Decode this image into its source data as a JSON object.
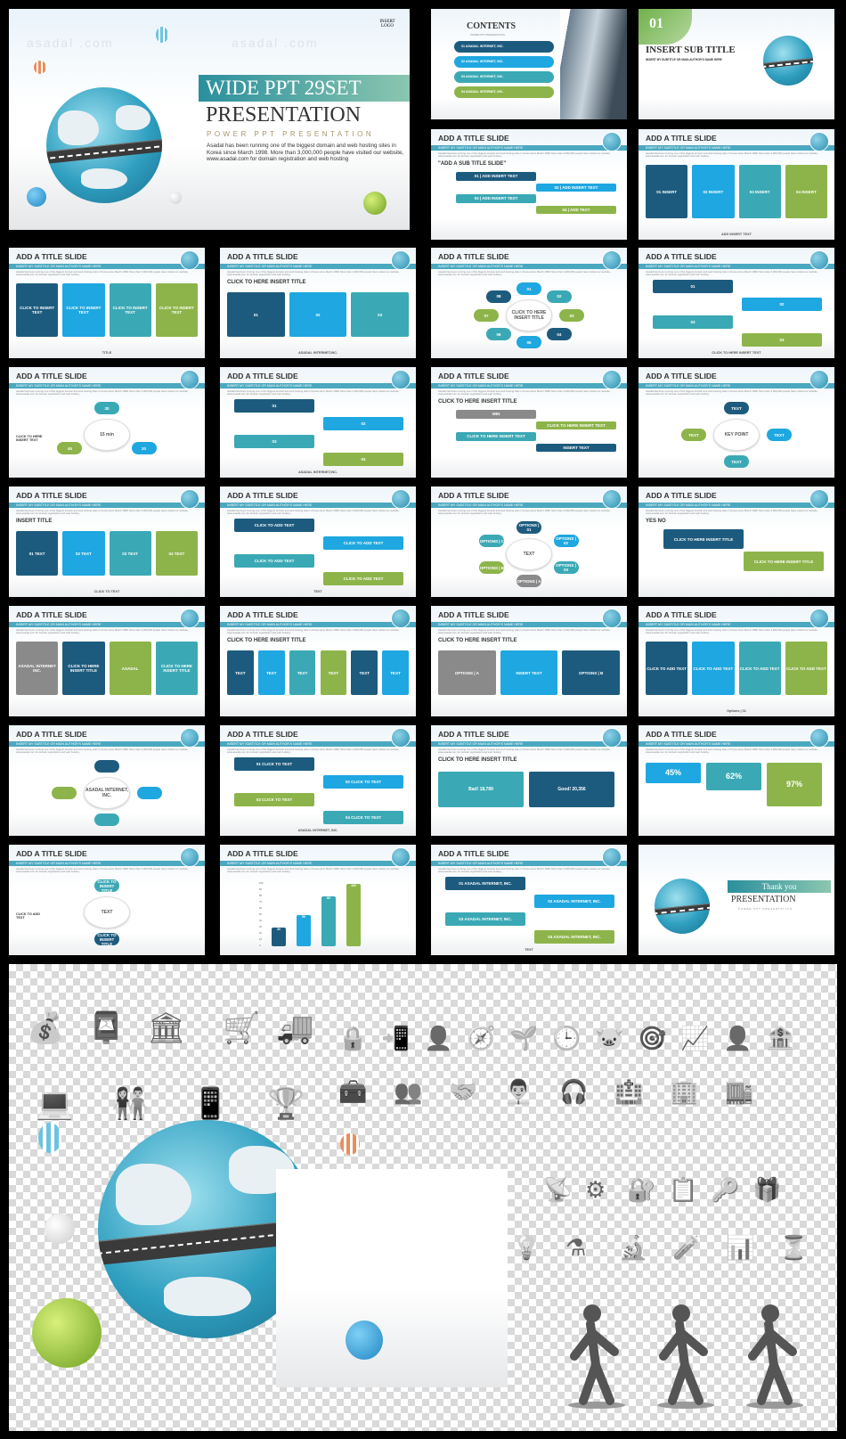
{
  "watermark": "asadal .com",
  "colors": {
    "navy": "#1d5b7e",
    "blue": "#1ea7e0",
    "teal": "#3aa9b5",
    "green": "#8db44a",
    "bar": "#4aa8c0",
    "gray": "#8a8a8a"
  },
  "cover": {
    "logo": "INSERT LOGO",
    "title": "WIDE PPT 29SET",
    "heading": "PRESENTATION",
    "subtitle": "POWER PPT PRESENTATION",
    "description": "Asadal has been running one of the biggest domain and web hosting sites in Korea since March 1998. More than 3,000,000 people have visited our website,  www.asadal.com  for domain registration and web hosting"
  },
  "common": {
    "slide_title": "ADD A TITLE SLIDE",
    "slide_subtitle": "INSERT MY SUBTITLE OR MAIN AUTHOR'S NAME HERE",
    "slide_body": "Asadal has been running one of the biggest domain and web hosting sites in Korea since March 1998. More than 3,000,000 people have visited our website, www.asadal.com for domain registration and web hosting."
  },
  "slides": [
    {
      "kind": "contents",
      "title": "CONTENTS",
      "subtitle": "POWER PPT PRESENTATION",
      "items": [
        {
          "text": "01  ASADAL INTERNET, INC.",
          "color": "navy"
        },
        {
          "text": "02  ASADAL INTERNET, INC.",
          "color": "blue"
        },
        {
          "text": "03  ASADAL INTERNET, INC.",
          "color": "teal"
        },
        {
          "text": "04  ASADAL INTERNET, INC.",
          "color": "green"
        }
      ]
    },
    {
      "kind": "section",
      "number": "01",
      "title": "INSERT SUB TITLE",
      "subtitle": "INSERT MY SUBTITLE OR MAIN AUTHOR'S NAME HERE"
    },
    {
      "kind": "stagger",
      "heading": "\"ADD A SUB TITLE SLIDE\"",
      "items": [
        {
          "text": "01 | ADD INSERT TEXT",
          "color": "navy"
        },
        {
          "text": "02 | ADD INSERT TEXT",
          "color": "blue"
        },
        {
          "text": "03 | ADD INSERT TEXT",
          "color": "teal"
        },
        {
          "text": "04 | ADD TEXT",
          "color": "green"
        }
      ]
    },
    {
      "kind": "row",
      "items": [
        {
          "text": "01 INSERT",
          "color": "navy"
        },
        {
          "text": "02 INSERT",
          "color": "blue"
        },
        {
          "text": "03 INSERT",
          "color": "teal"
        },
        {
          "text": "04 INSERT",
          "color": "green"
        }
      ],
      "caption": "ADD INSERT TEXT"
    },
    {
      "kind": "row",
      "items": [
        {
          "text": "CLICK TO INSERT TEXT",
          "color": "navy"
        },
        {
          "text": "CLICK TO INSERT TEXT",
          "color": "blue"
        },
        {
          "text": "CLICK TO INSERT TEXT",
          "color": "teal"
        },
        {
          "text": "CLICK TO INSERT TEXT",
          "color": "green"
        }
      ],
      "caption": "TITLE"
    },
    {
      "kind": "row",
      "heading": "CLICK TO HERE INSERT TITLE",
      "items": [
        {
          "text": "01",
          "color": "navy"
        },
        {
          "text": "02",
          "color": "blue"
        },
        {
          "text": "03",
          "color": "teal"
        }
      ],
      "caption": "ASADAL INTERNET,INC."
    },
    {
      "kind": "circle",
      "center": "CLICK TO HERE INSERT TITLE",
      "items": [
        {
          "text": "01",
          "color": "blue"
        },
        {
          "text": "02",
          "color": "teal"
        },
        {
          "text": "03",
          "color": "green"
        },
        {
          "text": "04",
          "color": "navy"
        },
        {
          "text": "05",
          "color": "blue"
        },
        {
          "text": "06",
          "color": "teal"
        },
        {
          "text": "07",
          "color": "green"
        },
        {
          "text": "08",
          "color": "navy"
        }
      ]
    },
    {
      "kind": "col",
      "items": [
        {
          "text": "01",
          "color": "navy"
        },
        {
          "text": "02",
          "color": "blue"
        },
        {
          "text": "03",
          "color": "teal"
        },
        {
          "text": "04",
          "color": "green"
        }
      ],
      "caption": "CLICK TO HERE INSERT TEXT"
    },
    {
      "kind": "circle",
      "center": "15 min",
      "items": [
        {
          "text": "30",
          "color": "teal"
        },
        {
          "text": "20",
          "color": "blue"
        },
        {
          "text": "45",
          "color": "green"
        }
      ],
      "side": "CLICK TO HERE INSERT TEXT"
    },
    {
      "kind": "col",
      "items": [
        {
          "text": "01",
          "color": "navy"
        },
        {
          "text": "02",
          "color": "blue"
        },
        {
          "text": "03",
          "color": "teal"
        },
        {
          "text": "04",
          "color": "green"
        }
      ],
      "caption": "ASADAL INTERNET,INC."
    },
    {
      "kind": "stagger",
      "heading": "CLICK TO HERE INSERT TITLE",
      "items": [
        {
          "text": "WIN",
          "color": "gray"
        },
        {
          "text": "CLICK TO HERE INSERT TEXT",
          "color": "green"
        },
        {
          "text": "CLICK TO HERE INSERT TEXT",
          "color": "teal"
        },
        {
          "text": "INSERT TEXT",
          "color": "navy"
        }
      ]
    },
    {
      "kind": "circle",
      "center": "KEY POINT",
      "items": [
        {
          "text": "TEXT",
          "color": "navy"
        },
        {
          "text": "TEXT",
          "color": "blue"
        },
        {
          "text": "TEXT",
          "color": "teal"
        },
        {
          "text": "TEXT",
          "color": "green"
        }
      ]
    },
    {
      "kind": "row",
      "heading": "INSERT TITLE",
      "items": [
        {
          "text": "01 TEXT",
          "color": "navy"
        },
        {
          "text": "02 TEXT",
          "color": "blue"
        },
        {
          "text": "03 TEXT",
          "color": "teal"
        },
        {
          "text": "04 TEXT",
          "color": "green"
        }
      ],
      "caption": "CLICK TO TEXT"
    },
    {
      "kind": "col",
      "items": [
        {
          "text": "CLICK TO ADD TEXT",
          "color": "navy"
        },
        {
          "text": "CLICK TO ADD TEXT",
          "color": "blue"
        },
        {
          "text": "CLICK TO ADD TEXT",
          "color": "teal"
        },
        {
          "text": "CLICK TO ADD TEXT",
          "color": "green"
        }
      ],
      "caption": "TEXT"
    },
    {
      "kind": "circle",
      "center": "TEXT",
      "items": [
        {
          "text": "OPTIONS | 01",
          "color": "navy"
        },
        {
          "text": "OPTIONS | 02",
          "color": "blue"
        },
        {
          "text": "OPTIONS | 03",
          "color": "teal"
        },
        {
          "text": "OPTIONS | A",
          "color": "gray"
        },
        {
          "text": "OPTIONS | B",
          "color": "green"
        },
        {
          "text": "OPTIONS | C",
          "color": "teal"
        }
      ]
    },
    {
      "kind": "stagger",
      "heading": "YES  NO",
      "items": [
        {
          "text": "CLICK TO HERE INSERT TITLE",
          "color": "navy"
        },
        {
          "text": "CLICK TO HERE INSERT TITLE",
          "color": "green"
        }
      ]
    },
    {
      "kind": "row",
      "items": [
        {
          "text": "ASADAL INTERNET INC.",
          "color": "gray"
        },
        {
          "text": "CLICK TO HERE INSERT TITLE",
          "color": "navy"
        },
        {
          "text": "ASADAL",
          "color": "green"
        },
        {
          "text": "CLICK TO HERE INSERT TITLE",
          "color": "teal"
        }
      ],
      "caption": ""
    },
    {
      "kind": "row",
      "heading": "CLICK TO HERE INSERT TITLE",
      "items": [
        {
          "text": "TEXT",
          "color": "navy"
        },
        {
          "text": "TEXT",
          "color": "blue"
        },
        {
          "text": "TEXT",
          "color": "teal"
        },
        {
          "text": "TEXT",
          "color": "green"
        },
        {
          "text": "TEXT",
          "color": "navy"
        },
        {
          "text": "TEXT",
          "color": "blue"
        }
      ],
      "caption": ""
    },
    {
      "kind": "row",
      "heading": "CLICK TO HERE INSERT TITLE",
      "items": [
        {
          "text": "OPTIONS | A",
          "color": "gray"
        },
        {
          "text": "INSERT TEXT",
          "color": "blue"
        },
        {
          "text": "OPTIONS | B",
          "color": "navy"
        }
      ],
      "caption": ""
    },
    {
      "kind": "row",
      "items": [
        {
          "text": "CLICK TO ADD TEXT",
          "color": "navy"
        },
        {
          "text": "CLICK TO ADD TEXT",
          "color": "blue"
        },
        {
          "text": "CLICK TO ADD TEXT",
          "color": "teal"
        },
        {
          "text": "CLICK TO ADD TEXT",
          "color": "green"
        }
      ],
      "caption": "Options | 01"
    },
    {
      "kind": "circle",
      "center": "ASADAL INTERNET, INC.",
      "items": [
        {
          "text": "",
          "color": "navy"
        },
        {
          "text": "",
          "color": "blue"
        },
        {
          "text": "",
          "color": "teal"
        },
        {
          "text": "",
          "color": "green"
        }
      ]
    },
    {
      "kind": "col",
      "items": [
        {
          "text": "01 CLICK TO TEXT",
          "color": "navy"
        },
        {
          "text": "02 CLICK TO TEXT",
          "color": "blue"
        },
        {
          "text": "03 CLICK TO TEXT",
          "color": "green"
        },
        {
          "text": "04 CLICK TO TEXT",
          "color": "teal"
        }
      ],
      "caption": "ASADAL INTERNET, INC."
    },
    {
      "kind": "stats",
      "items": [
        {
          "text": "Bad! 18,789",
          "color": "teal"
        },
        {
          "text": "Good! 20,356",
          "color": "navy"
        }
      ],
      "heading": "CLICK TO HERE INSERT TITLE"
    },
    {
      "kind": "stats",
      "items": [
        {
          "text": "45%",
          "color": "blue",
          "value": 45
        },
        {
          "text": "62%",
          "color": "teal",
          "value": 62
        },
        {
          "text": "97%",
          "color": "green",
          "value": 97
        }
      ]
    },
    {
      "kind": "circle",
      "center": "TEXT",
      "items": [
        {
          "text": "CLICK TO INSERT TITLE",
          "color": "teal"
        },
        {
          "text": "CLICK TO INSERT TITLE",
          "color": "navy"
        }
      ],
      "side": "CLICK TO ADD TEXT"
    },
    {
      "kind": "bars",
      "items": [
        {
          "text": "30",
          "color": "navy",
          "value": 30
        },
        {
          "text": "50",
          "color": "blue",
          "value": 50
        },
        {
          "text": "80",
          "color": "teal",
          "value": 80
        },
        {
          "text": "100",
          "color": "green",
          "value": 100
        }
      ],
      "ticks": [
        "0",
        "10",
        "20",
        "30",
        "40",
        "50",
        "60",
        "70",
        "80",
        "90",
        "100"
      ]
    },
    {
      "kind": "col",
      "items": [
        {
          "text": "01 ASADAL INTERNET, INC.",
          "color": "navy"
        },
        {
          "text": "02 ASADAL INTERNET, INC.",
          "color": "blue"
        },
        {
          "text": "03 ASADAL INTERNET, INC.",
          "color": "teal"
        },
        {
          "text": "04 ASADAL INTERNET, INC.",
          "color": "green"
        }
      ],
      "caption": "TEXT"
    },
    {
      "kind": "thanks",
      "title": "Thank you",
      "heading": "PRESENTATION",
      "subtitle": "POWER PPT PRESENTATION"
    }
  ],
  "assets": {
    "icons_left": [
      "💰",
      "📮",
      "🏛",
      "🛒",
      "🚚",
      "💻",
      "👫",
      "📱",
      "🏆"
    ],
    "icons_right": [
      "🔒",
      "📲",
      "👤",
      "🧭",
      "🌱",
      "🕒",
      "🐷",
      "🎯",
      "📈",
      "👤",
      "🏦",
      "🧰",
      "👥",
      "🤝",
      "👨‍💼",
      "🎧",
      "🏥",
      "🏢",
      "🏬",
      "📡",
      "⚙",
      "🔐",
      "📋",
      "🔑",
      "🎁",
      "💡",
      "⚗",
      "🔬",
      "🧪",
      "📊",
      "⏳"
    ],
    "figures": [
      "person-pushing",
      "person-lifting",
      "person-carrying"
    ]
  }
}
